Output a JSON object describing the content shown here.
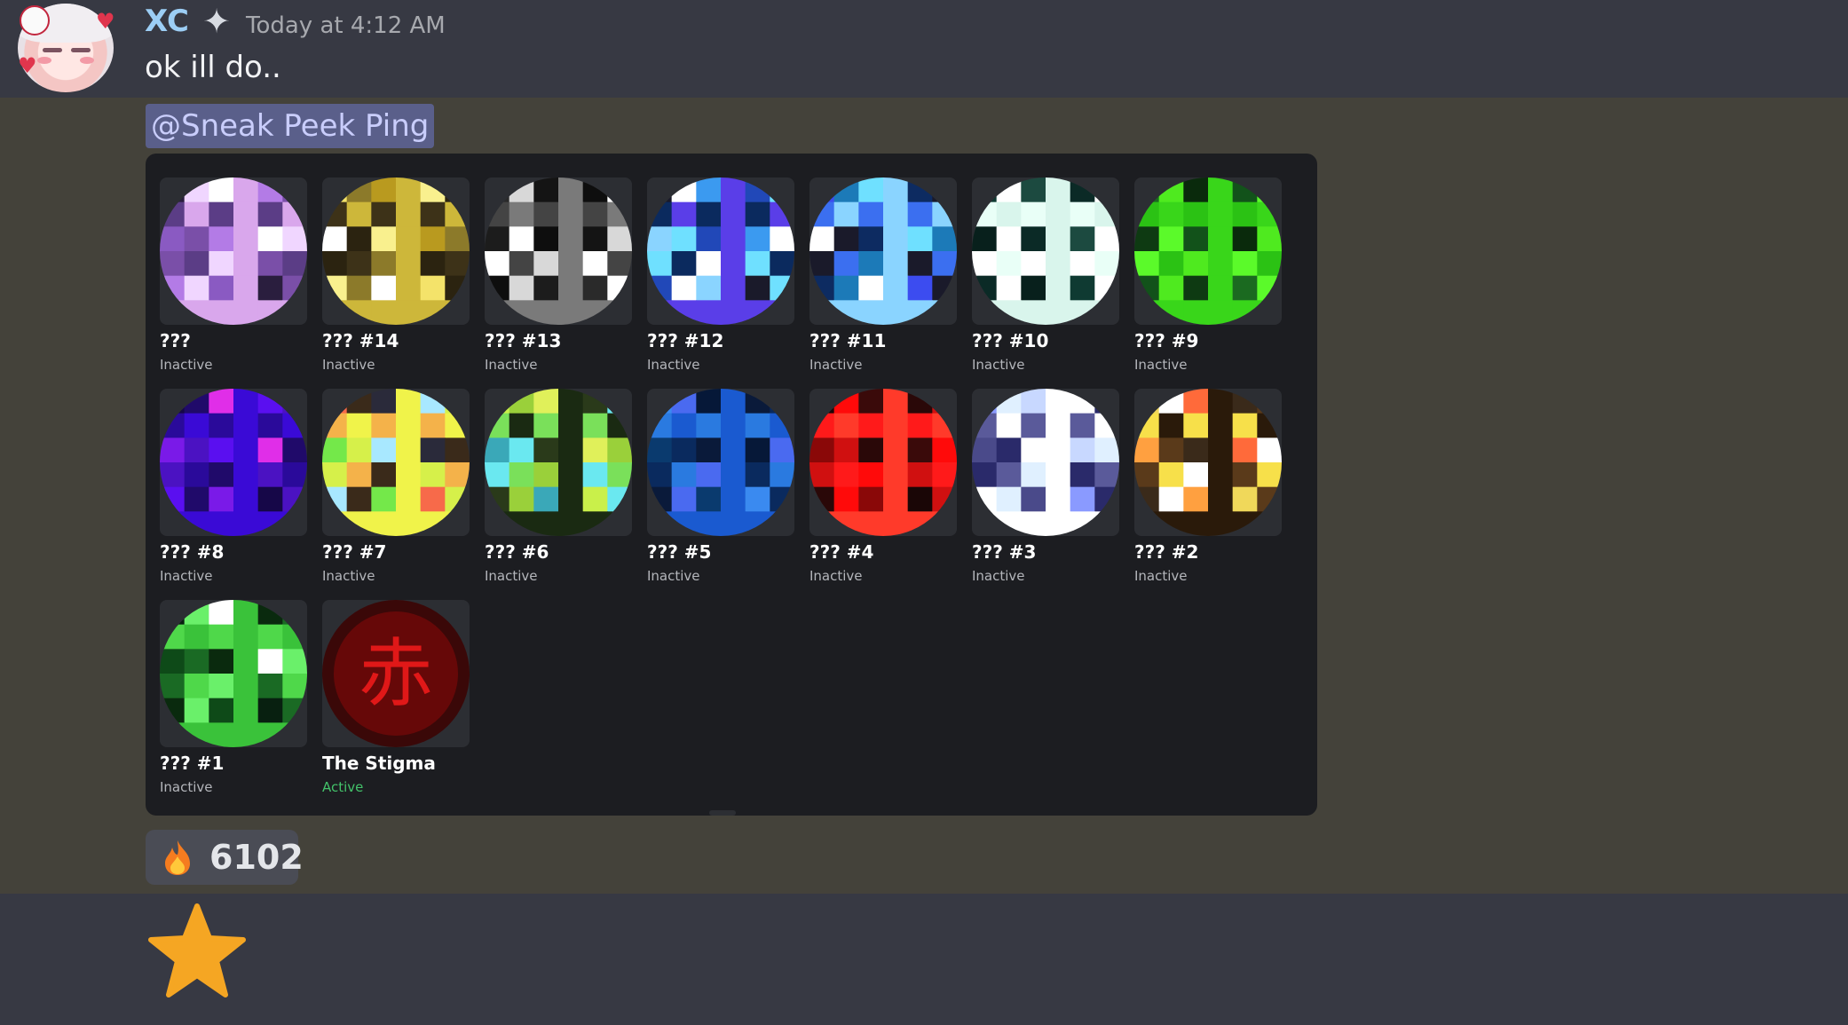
{
  "message": {
    "username": "XC",
    "timestamp": "Today at 4:12 AM",
    "text": "ok ill do..",
    "mention": "@Sneak Peek Ping",
    "user_color": "#9ccef5"
  },
  "grid": {
    "items": [
      {
        "name": "???",
        "status": "Inactive",
        "palette": [
          "#2a1e3e",
          "#d9a7ec",
          "#8a5ac2",
          "#f0d6ff",
          "#b37be6",
          "#5b3d86",
          "#ffffff",
          "#7a4fa8"
        ]
      },
      {
        "name": "??? #14",
        "status": "Inactive",
        "palette": [
          "#2b2310",
          "#f4e36a",
          "#cdb73a",
          "#ffffff",
          "#8c7a2a",
          "#f9f08e",
          "#3d3218",
          "#b99a1f"
        ]
      },
      {
        "name": "??? #13",
        "status": "Inactive",
        "palette": [
          "#141414",
          "#ffffff",
          "#2a2a2a",
          "#7a7a7a",
          "#1c1c1c",
          "#d8d8d8",
          "#0e0e0e",
          "#444444"
        ]
      },
      {
        "name": "??? #12",
        "status": "Inactive",
        "palette": [
          "#0b2a5e",
          "#3b9af0",
          "#6fe0ff",
          "#1a1a2a",
          "#5a3ee8",
          "#8ad4ff",
          "#ffffff",
          "#2148b8"
        ]
      },
      {
        "name": "??? #11",
        "status": "Inactive",
        "palette": [
          "#0d2b61",
          "#3b6ff0",
          "#6fe0ff",
          "#1a1a2a",
          "#3c4cf0",
          "#8ad4ff",
          "#ffffff",
          "#1c7ab8"
        ]
      },
      {
        "name": "??? #10",
        "status": "Inactive",
        "palette": [
          "#ffffff",
          "#0b2a26",
          "#e9fff7",
          "#1c4a40",
          "#ffffff",
          "#0f3a32",
          "#d9f5ec",
          "#08201c"
        ]
      },
      {
        "name": "??? #9",
        "status": "Inactive",
        "palette": [
          "#0e3a12",
          "#4fea1f",
          "#12521a",
          "#2bc214",
          "#0a2a0c",
          "#5bfa2a",
          "#1b6a20",
          "#39d61a"
        ]
      },
      {
        "name": "??? #8",
        "status": "Inactive",
        "palette": [
          "#3a0ad6",
          "#7a1ae8",
          "#200a6a",
          "#5a0ff0",
          "#2a0a9a",
          "#e02ee8",
          "#4b12c2",
          "#160748"
        ]
      },
      {
        "name": "??? #7",
        "status": "Inactive",
        "palette": [
          "#f76a4a",
          "#f0f34a",
          "#74e84a",
          "#3a2a1a",
          "#a8e8ff",
          "#f4b24a",
          "#2a2a3a",
          "#d6f04a"
        ]
      },
      {
        "name": "??? #6",
        "status": "Inactive",
        "palette": [
          "#6ae8f0",
          "#c9f04a",
          "#1a2a12",
          "#3aa8b8",
          "#9ad03a",
          "#2a3a1a",
          "#7ae05a",
          "#e0f05a"
        ]
      },
      {
        "name": "??? #5",
        "status": "Inactive",
        "palette": [
          "#061838",
          "#0a2a5e",
          "#3a8af0",
          "#1a5ad0",
          "#0a3a6e",
          "#4a6af0",
          "#0a1a3a",
          "#2a7ae0"
        ]
      },
      {
        "name": "??? #4",
        "status": "Inactive",
        "palette": [
          "#ff1a1a",
          "#3a0a0a",
          "#d01010",
          "#1a0606",
          "#ff3a2a",
          "#8a0808",
          "#ff0a0a",
          "#2a0808"
        ]
      },
      {
        "name": "??? #3",
        "status": "Inactive",
        "palette": [
          "#ffffff",
          "#5a5a9a",
          "#c8d8ff",
          "#2a2a6a",
          "#8a9aff",
          "#ffffff",
          "#4a4a8a",
          "#e0f0ff"
        ]
      },
      {
        "name": "??? #2",
        "status": "Inactive",
        "palette": [
          "#ffffff",
          "#3a2a1a",
          "#f7e04a",
          "#ff6a3a",
          "#5a3a1a",
          "#f0d85a",
          "#2a1a0a",
          "#ffa040"
        ]
      },
      {
        "name": "??? #1",
        "status": "Inactive",
        "palette": [
          "#0e4a18",
          "#6af06a",
          "#0a2a0e",
          "#4fd84a",
          "#ffffff",
          "#1a6a24",
          "#082010",
          "#3ac23a"
        ]
      },
      {
        "name": "The Stigma",
        "status": "Active",
        "stigma": true,
        "palette": [
          "#3a0808",
          "#8a0a0a"
        ]
      }
    ]
  },
  "reaction": {
    "icon": "fire-icon",
    "count": "6102"
  },
  "bottom": {
    "icon": "star-icon",
    "color": "#f5a623"
  }
}
